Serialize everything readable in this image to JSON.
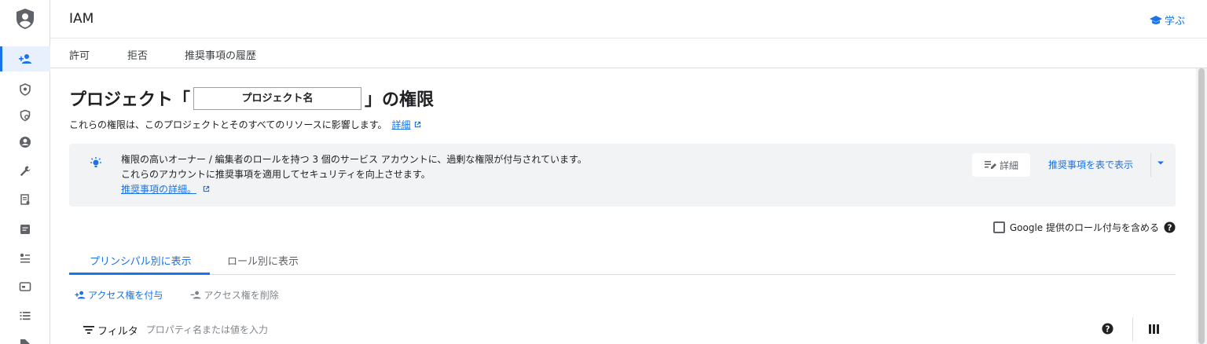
{
  "header": {
    "title": "IAM",
    "learn_label": "学ぶ"
  },
  "subtabs": [
    {
      "label": "許可"
    },
    {
      "label": "拒否"
    },
    {
      "label": "推奨事項の履歴"
    }
  ],
  "page": {
    "title_prefix": "プロジェクト「",
    "project_name": "プロジェクト名",
    "title_suffix": "」の権限",
    "description": "これらの権限は、このプロジェクトとそのすべてのリソースに影響します。",
    "details_link": "詳細"
  },
  "banner": {
    "line1": "権限の高いオーナー / 編集者のロールを持つ 3 個のサービス アカウントに、過剰な権限が付与されています。",
    "line2": "これらのアカウントに推奨事項を適用してセキュリティを向上させます。",
    "link": "推奨事項の詳細。",
    "detail_button": "詳細",
    "recommend_button": "推奨事項を表で表示"
  },
  "include_google_roles": {
    "label": "Google 提供のロール付与を含める",
    "checked": false
  },
  "view_tabs": [
    {
      "label": "プリンシパル別に表示",
      "active": true
    },
    {
      "label": "ロール別に表示",
      "active": false
    }
  ],
  "actions": {
    "grant": "アクセス権を付与",
    "revoke": "アクセス権を削除"
  },
  "filter": {
    "label": "フィルタ",
    "placeholder": "プロパティ名または値を入力"
  },
  "colors": {
    "accent": "#1a73e8",
    "banner_bg": "#f1f3f4",
    "active_nav_bg": "#e8f0fe"
  }
}
